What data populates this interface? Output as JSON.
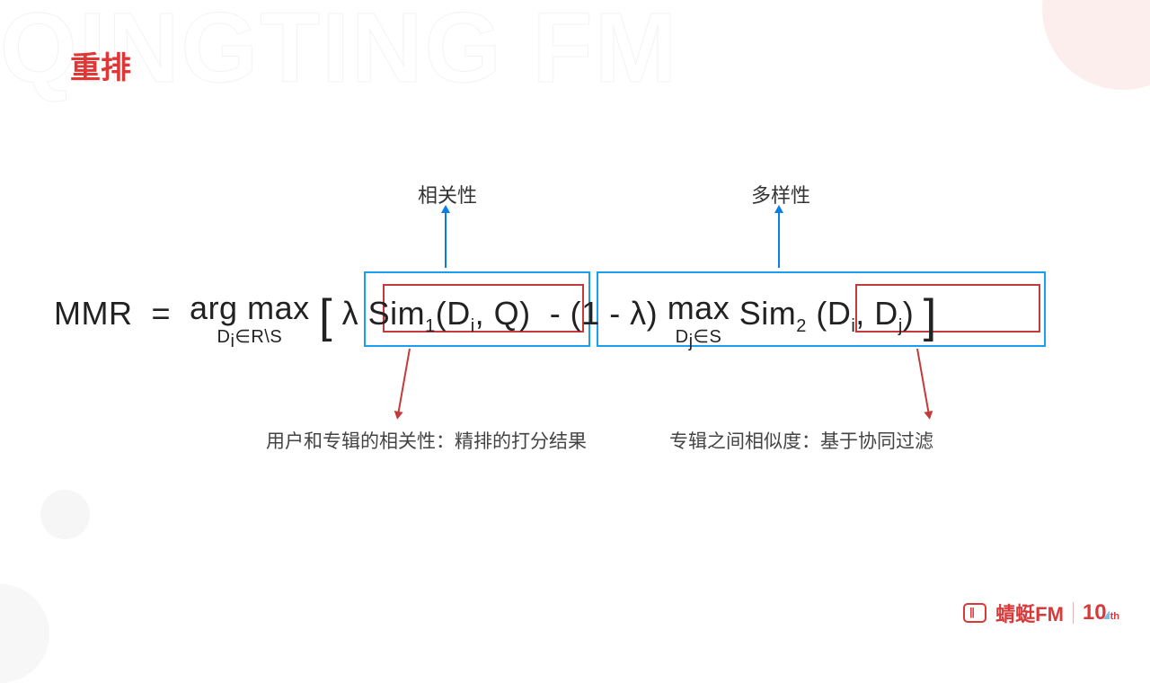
{
  "watermark": "QINGTING FM",
  "title": "重排",
  "annotations": {
    "top1": "相关性",
    "top2": "多样性",
    "bottom1": "用户和专辑的相关性：精排的打分结果",
    "bottom2": "专辑之间相似度：基于协同过滤"
  },
  "formula": {
    "lhs": "MMR",
    "eq": "=",
    "op_top": "arg max",
    "op_sub": "Di ∈ R\\S",
    "lbracket": "[",
    "lambda": "λ",
    "sim1": "Sim",
    "sim1_sub": "1",
    "args1": "(Di, Q)",
    "minus": "- (1 - λ)",
    "max2_top": " max",
    "max2_sub": "Dj ∈ S",
    "sim2": "Sim",
    "sim2_sub": "2",
    "args2": " (Di, Dj)",
    "rbracket": "]"
  },
  "footer": {
    "brand": "蜻蜓FM",
    "anniv_num": "10",
    "anniv_suffix": "th"
  }
}
